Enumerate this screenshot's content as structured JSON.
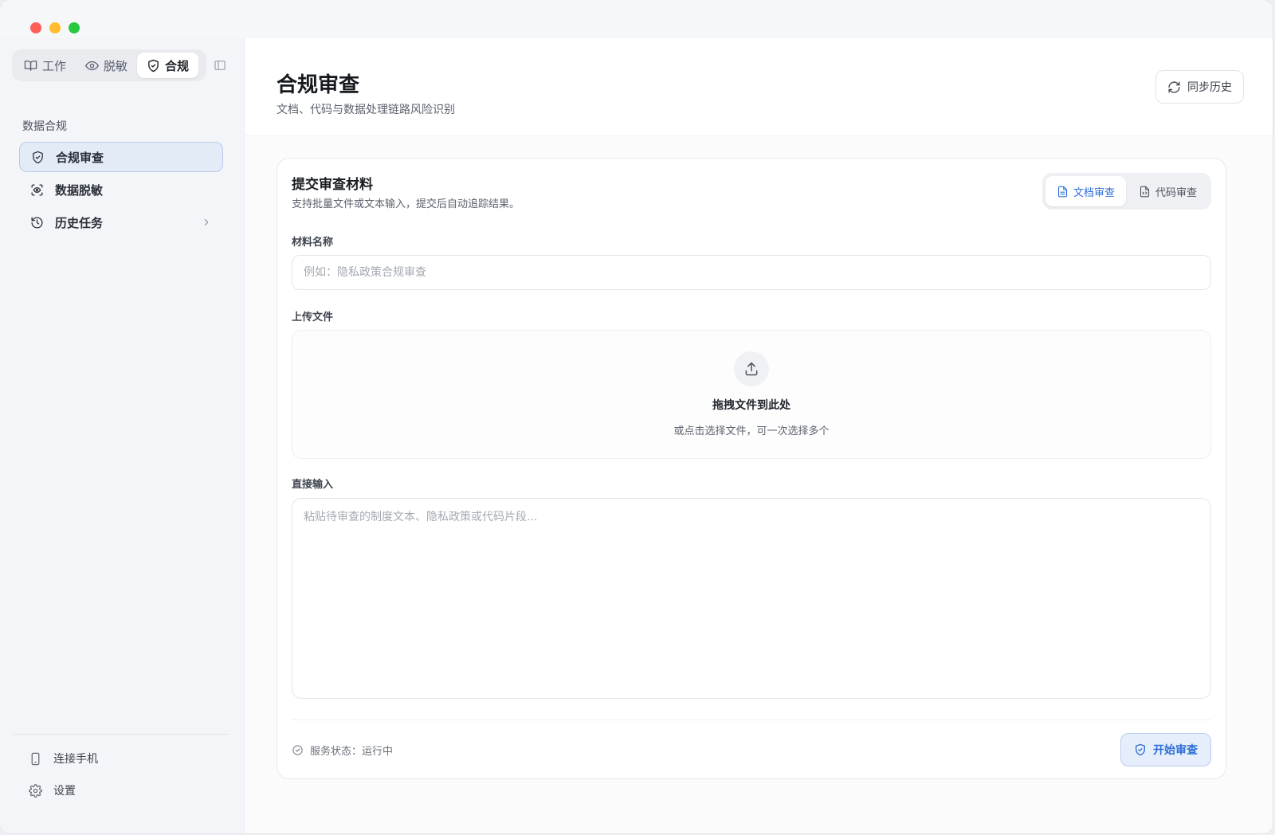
{
  "window": {
    "traffic_lights": [
      "close",
      "minimize",
      "zoom"
    ]
  },
  "sidebar": {
    "modes": [
      {
        "label": "工作",
        "icon": "book-icon"
      },
      {
        "label": "脱敏",
        "icon": "eye-icon"
      },
      {
        "label": "合规",
        "icon": "shield-icon",
        "active": true
      }
    ],
    "section_title": "数据合规",
    "nav": [
      {
        "label": "合规审查",
        "icon": "shield-check-icon",
        "active": true
      },
      {
        "label": "数据脱敏",
        "icon": "scan-eye-icon"
      },
      {
        "label": "历史任务",
        "icon": "history-icon"
      }
    ],
    "bottom": {
      "connect_phone": "连接手机",
      "settings": "设置"
    }
  },
  "header": {
    "title": "合规审查",
    "subtitle": "文档、代码与数据处理链路风险识别",
    "sync_label": "同步历史"
  },
  "card": {
    "title": "提交审查材料",
    "description": "支持批量文件或文本输入，提交后自动追踪结果。",
    "tabs": [
      {
        "label": "文档审查",
        "active": true
      },
      {
        "label": "代码审查"
      }
    ],
    "name_field": {
      "label": "材料名称",
      "placeholder": "例如：隐私政策合规审查",
      "value": ""
    },
    "upload": {
      "label": "上传文件",
      "title": "拖拽文件到此处",
      "description": "或点击选择文件，可一次选择多个"
    },
    "direct_input": {
      "label": "直接输入",
      "placeholder": "粘贴待审查的制度文本、隐私政策或代码片段...",
      "value": ""
    },
    "status_text": "服务状态：运行中",
    "start_label": "开始审查"
  },
  "colors": {
    "accent": "#2f6fd6",
    "accent_bg": "#e6eefb",
    "close": "#ff5f57",
    "minimize": "#febc2e",
    "zoom": "#28c840"
  }
}
